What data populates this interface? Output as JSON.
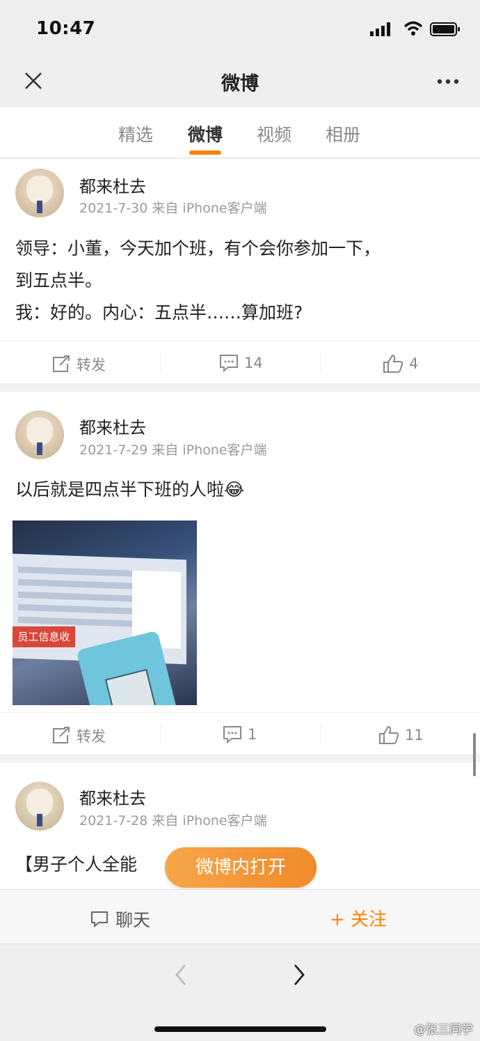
{
  "status_bar": {
    "time": "10:47"
  },
  "nav": {
    "title": "微博"
  },
  "tabs": [
    {
      "label": "精选"
    },
    {
      "label": "微博"
    },
    {
      "label": "视频"
    },
    {
      "label": "相册"
    }
  ],
  "posts": [
    {
      "username": "都来杜去",
      "meta": "2021-7-30 来自 iPhone客户端",
      "lines": [
        "领导：小董，今天加个班，有个会你参加一下，",
        "到五点半。",
        "我：好的。内心：五点半……算加班?"
      ],
      "repost_label": "转发",
      "comments": "14",
      "likes": "4"
    },
    {
      "username": "都来杜去",
      "meta": "2021-7-29 来自 iPhone客户端",
      "lines": [
        "以后就是四点半下班的人啦😂"
      ],
      "image_badge": "员工信息收",
      "repost_label": "转发",
      "comments": "1",
      "likes": "11"
    },
    {
      "username": "都来杜去",
      "meta": "2021-7-28 来自 iPhone客户端",
      "lines": [
        "【男子个人全能"
      ]
    }
  ],
  "open_in_app": "微博内打开",
  "bottom": {
    "chat_label": "聊天",
    "follow_label": "+ 关注"
  },
  "watermark": "@张三同学",
  "colors": {
    "accent": "#ff8200",
    "pill": "#f39a3a"
  }
}
